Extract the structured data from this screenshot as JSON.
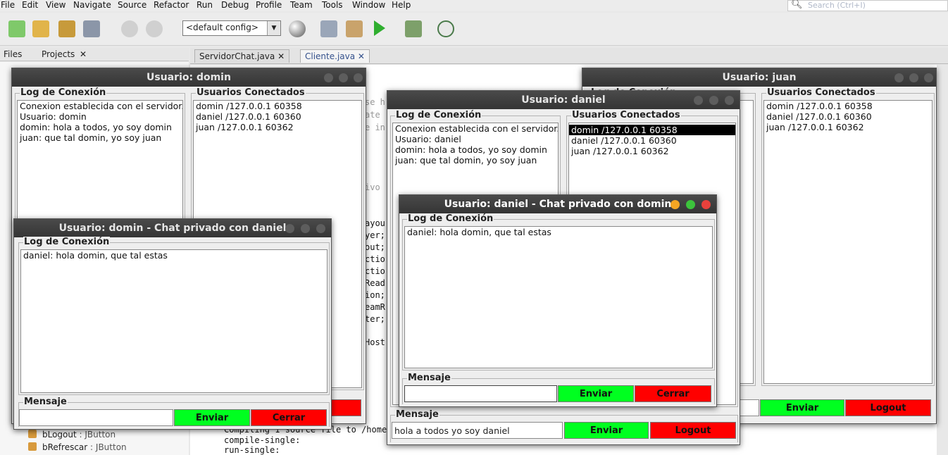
{
  "ide": {
    "menu": [
      "File",
      "Edit",
      "View",
      "Navigate",
      "Source",
      "Refactor",
      "Run",
      "Debug",
      "Profile",
      "Team",
      "Tools",
      "Window",
      "Help"
    ],
    "search_placeholder": "Search (Ctrl+I)",
    "config": "<default config>",
    "side_tabs": [
      "Files",
      "Projects"
    ],
    "editor_tabs": [
      "ServidorChat.java",
      "Cliente.java"
    ],
    "tree_items": [
      {
        "name": "bLogout",
        "type": ": JButton"
      },
      {
        "name": "bRefrescar",
        "type": ": JButton"
      }
    ],
    "code_fragments": [
      "se h",
      "ate",
      "e in",
      "ivo",
      "ayou",
      "yer;",
      "out;",
      "ctio",
      "ctio",
      "Read",
      "ion;",
      "eamR",
      "ter;",
      "Host"
    ],
    "output_lines": [
      "Compiling 1 source file to /home/dom",
      "compile-single:",
      "run-single:"
    ]
  },
  "win_juan": {
    "title": "Usuario: juan",
    "log_label": "Log de Conexión",
    "users_label": "Usuarios Conectados",
    "users": [
      "domin /127.0.0.1 60358",
      "daniel /127.0.0.1 60360",
      "juan /127.0.0.1 60362"
    ],
    "send": "Enviar",
    "logout": "Logout"
  },
  "win_domin": {
    "title": "Usuario: domin",
    "log_label": "Log de Conexión",
    "log": [
      "Conexion establecida con el servidor.",
      "Usuario: domin",
      "domin: hola a todos, yo soy domin",
      "juan: que tal domin, yo soy juan"
    ],
    "users_label": "Usuarios Conectados",
    "users": [
      "domin /127.0.0.1 60358",
      "daniel /127.0.0.1 60360",
      "juan /127.0.0.1 60362"
    ]
  },
  "win_daniel": {
    "title": "Usuario: daniel",
    "log_label": "Log de Conexión",
    "log": [
      "Conexion establecida con el servidor.",
      "Usuario: daniel",
      "domin: hola a todos, yo soy domin",
      "juan: que tal domin, yo soy juan"
    ],
    "users_label": "Usuarios Conectados",
    "users": [
      "domin /127.0.0.1 60358",
      "daniel /127.0.0.1 60360",
      "juan /127.0.0.1 60362"
    ],
    "message_label": "Mensaje",
    "message_value": "hola a todos yo soy daniel",
    "send": "Enviar",
    "logout": "Logout"
  },
  "win_domin_private": {
    "title": "Usuario: domin - Chat privado con daniel",
    "log_label": "Log de Conexión",
    "log": [
      "daniel: hola domin, que tal estas"
    ],
    "message_label": "Mensaje",
    "message_value": "",
    "send": "Enviar",
    "close": "Cerrar"
  },
  "win_daniel_private": {
    "title": "Usuario: daniel - Chat privado con domin",
    "log_label": "Log de Conexión",
    "log": [
      "daniel: hola domin, que tal estas"
    ],
    "message_label": "Mensaje",
    "message_value": "",
    "send": "Enviar",
    "close": "Cerrar"
  },
  "colors": {
    "send_button": "#00ff20",
    "close_button": "#ff0000",
    "titlebar": "#3c3c3c",
    "traffic_min": "#f5a623",
    "traffic_max": "#3cc43c",
    "traffic_close": "#e8413c"
  }
}
